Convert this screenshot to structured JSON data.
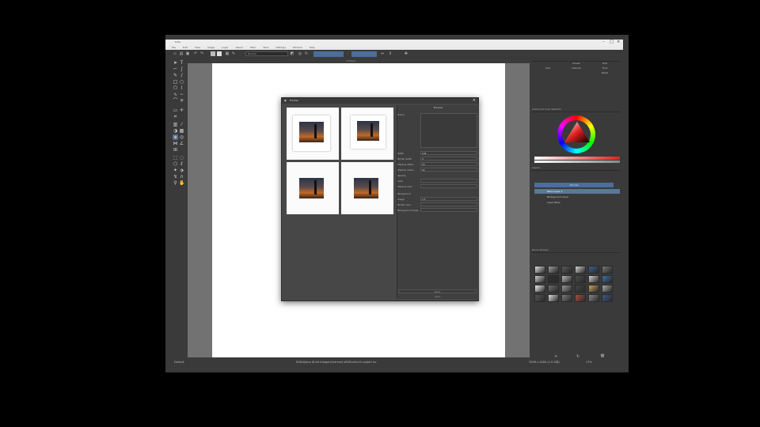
{
  "window": {
    "title": "Krita"
  },
  "menu": [
    "File",
    "Edit",
    "View",
    "Image",
    "Layer",
    "Select",
    "Filter",
    "Tools",
    "Settings",
    "Window",
    "Help"
  ],
  "toolbar": {
    "workspace_label": "Sketch",
    "preset_label": "Default",
    "blending_value": "Normal"
  },
  "document_tab": {
    "label": "Untitled"
  },
  "dialog": {
    "title": "Frames",
    "preview_label": "Preview",
    "fields": [
      {
        "label": "Frame",
        "value": ""
      },
      {
        "label": "Width",
        "value": "128"
      },
      {
        "label": "Border width",
        "value": "4"
      },
      {
        "label": "Shadow offset",
        "value": "20"
      },
      {
        "label": "Shadow radius",
        "value": "40"
      },
      {
        "label": "Opacity",
        "value": "0.5"
      },
      {
        "label": "Color",
        "value": ""
      },
      {
        "label": "Shadow color",
        "value": ""
      },
      {
        "label": "Background",
        "value": ""
      },
      {
        "label": "Image",
        "value": "1.0"
      },
      {
        "label": "Border color",
        "value": ""
      },
      {
        "label": "Background image",
        "value": ""
      }
    ],
    "footer_button": "Apply",
    "footer_button2": "Close"
  },
  "dock": {
    "brush_panel_buttons": [
      "Preset",
      "Edit",
      "Size",
      "Opacity",
      "Flow",
      "Reset"
    ],
    "color_selector_label": "Advanced Color Selector",
    "layers_label": "Layers",
    "layers_blend": "Normal",
    "layers": [
      {
        "name": "Paint Layer 1"
      },
      {
        "name": "Background Layer"
      },
      {
        "name": "Layer Base"
      }
    ],
    "brush_presets_label": "Brush Presets"
  },
  "status": {
    "left": "Default",
    "center": "RGB/Alpha (8-bit integer/channel) sRGB-elle-V2-srgbtrl.icc",
    "right_size": "3508 x 2480 (1.0 GiB)",
    "zoom": "17%"
  },
  "colors": {
    "accent": "#4b6e9b",
    "selection": "#5a7898"
  }
}
